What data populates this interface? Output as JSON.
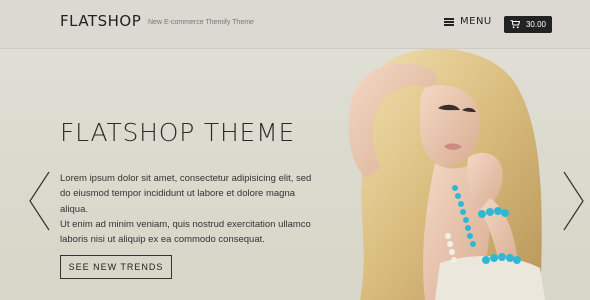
{
  "header": {
    "logo": "FLATSHOP",
    "tagline": "New E-commerce Themify Theme",
    "menu_label": "MENU",
    "menu_icon": "hamburger-icon",
    "cart_total": "30.00",
    "cart_icon": "shopping-cart-icon"
  },
  "hero": {
    "title": "FLATSHOP THEME",
    "paragraph_1": "Lorem ipsum dolor sit amet, consectetur adipisicing elit, sed do eiusmod tempor incididunt ut labore et dolore magna aliqua.",
    "paragraph_2": "Ut enim ad minim veniam, quis nostrud exercitation ullamco laboris nisi ut aliquip ex ea commodo consequat.",
    "cta_label": "SEE NEW TRENDS"
  },
  "slider": {
    "prev_icon": "chevron-left-icon",
    "next_icon": "chevron-right-icon"
  },
  "colors": {
    "background": "#dcdbd0",
    "text": "#222222",
    "cart_bg": "#222222",
    "necklace": "#2fb8d6"
  }
}
